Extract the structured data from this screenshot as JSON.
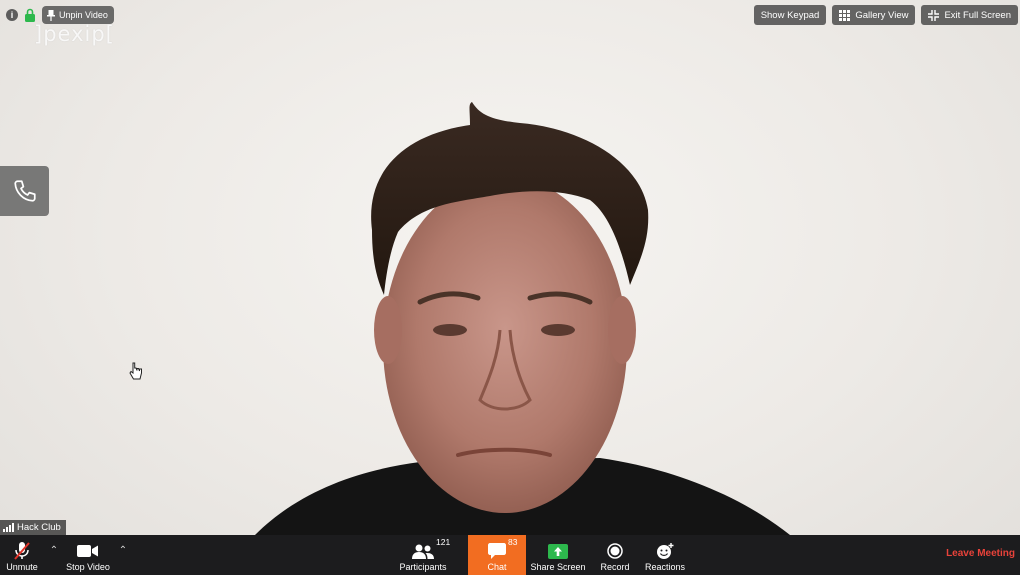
{
  "top_bar": {
    "info_icon": "info-icon",
    "lock_icon": "lock-icon",
    "unpin_label": "Unpin Video",
    "watermark": "]pexip[",
    "show_keypad_label": "Show Keypad",
    "gallery_view_label": "Gallery View",
    "exit_full_screen_label": "Exit Full Screen"
  },
  "side": {
    "phone_icon": "phone-icon"
  },
  "video": {
    "participant_name": "Hack Club"
  },
  "toolbar": {
    "unmute_label": "Unmute",
    "stop_video_label": "Stop Video",
    "participants_label": "Participants",
    "participants_count": "121",
    "chat_label": "Chat",
    "chat_count": "83",
    "share_screen_label": "Share Screen",
    "record_label": "Record",
    "reactions_label": "Reactions",
    "leave_label": "Leave Meeting"
  },
  "colors": {
    "toolbar_bg": "#1c1c1e",
    "chat_active": "#f26d21",
    "share_green": "#2db84d",
    "leave_red": "#e8423a",
    "mute_red": "#e0342a"
  }
}
